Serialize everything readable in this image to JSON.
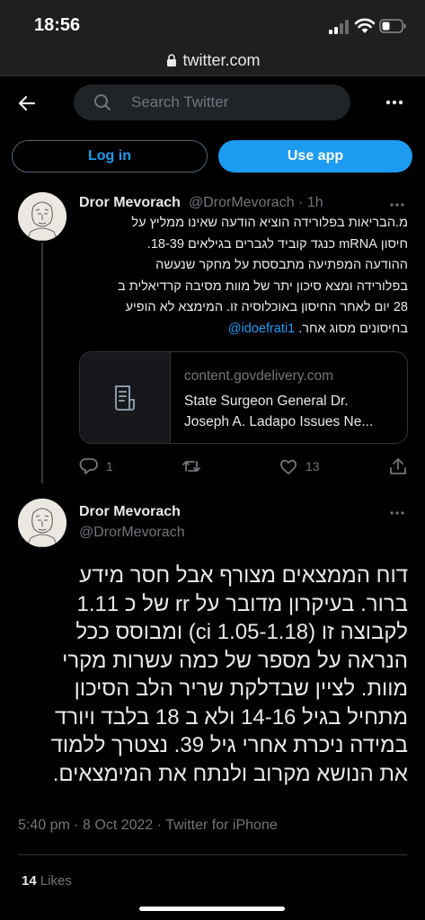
{
  "status_bar": {
    "time": "18:56"
  },
  "browser": {
    "url": "twitter.com"
  },
  "header": {
    "search_placeholder": "Search Twitter"
  },
  "auth": {
    "login_label": "Log in",
    "use_app_label": "Use app"
  },
  "tweet_reply_parent": {
    "name": "Dror Mevorach",
    "handle_time": "@DrorMevorach · 1h",
    "text_lines": [
      "מ.הבריאות בפלורידה הוציא הודעה שאינו ממליץ על",
      "חיסון mRNA כנגד קוביד לגברים בגילאים 18-39.",
      "ההודעה המפתיעה מתבססת על מחקר שנעשה",
      "בפלורידה ומצא סיכון יתר של מוות מסיבה קרדיאלית ב",
      "28 יום לאחר החיסון באוכלוסיה זו. המימצא לא הופיע",
      "בחיסונים מסוג אחר."
    ],
    "mention": "@idoefrati1",
    "card": {
      "domain": "content.govdelivery.com",
      "title_line1": "State Surgeon General Dr.",
      "title_line2": "Joseph A. Ladapo Issues Ne..."
    },
    "replies": "1",
    "retweets": "",
    "likes": "13"
  },
  "main_tweet": {
    "name": "Dror Mevorach",
    "handle": "@DrorMevorach",
    "text_lines": [
      "דוח הממצאים מצורף אבל חסר מידע",
      "ברור. בעיקרון מדובר על rr של כ 1.11",
      "לקבוצה זו (ci 1.05-1.18) ומבוסס ככל",
      "הנראה על מספר של כמה עשרות מקרי",
      "מוות. לציין שבדלקת שריר הלב הסיכון",
      "מתחיל בגיל 14-16 ולא ב 18 בלבד ויורד",
      "במידה ניכרת אחרי גיל 39. נצטרך ללמוד",
      "את הנושא מקרוב ולנתח את המימצאים."
    ],
    "meta": "5:40 pm · 8 Oct 2022 · Twitter for iPhone",
    "likes_count": "14",
    "likes_label": "Likes"
  },
  "icons": [
    "back-arrow-icon",
    "search-icon",
    "more-icon",
    "reply-icon",
    "retweet-icon",
    "like-icon",
    "share-icon",
    "document-icon",
    "lock-icon"
  ]
}
